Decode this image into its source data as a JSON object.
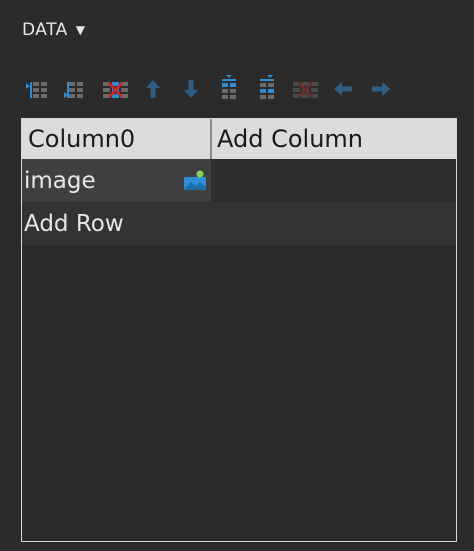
{
  "panel": {
    "title": "DATA",
    "caret": "▼"
  },
  "toolbar": {
    "buttons": [
      {
        "icon": "insert-column-before-icon"
      },
      {
        "icon": "insert-column-after-icon"
      },
      {
        "icon": "delete-column-icon"
      },
      {
        "icon": "arrow-up-icon"
      },
      {
        "icon": "arrow-down-icon"
      },
      {
        "icon": "insert-row-above-icon"
      },
      {
        "icon": "insert-row-below-icon"
      },
      {
        "icon": "delete-row-icon"
      },
      {
        "icon": "arrow-left-icon"
      },
      {
        "icon": "arrow-right-icon"
      }
    ]
  },
  "grid": {
    "headers": [
      "Column0",
      "Add Column"
    ],
    "rows": [
      {
        "cells": [
          "image",
          ""
        ],
        "icon": "image-icon"
      }
    ],
    "add_row_label": "Add Row"
  },
  "colors": {
    "icon_blue": "#2f8fd6",
    "icon_gray": "#6b6b6b",
    "delete_red": "#c62828",
    "header_bg": "#dcdcdc",
    "image_icon_green": "#7ed957"
  }
}
